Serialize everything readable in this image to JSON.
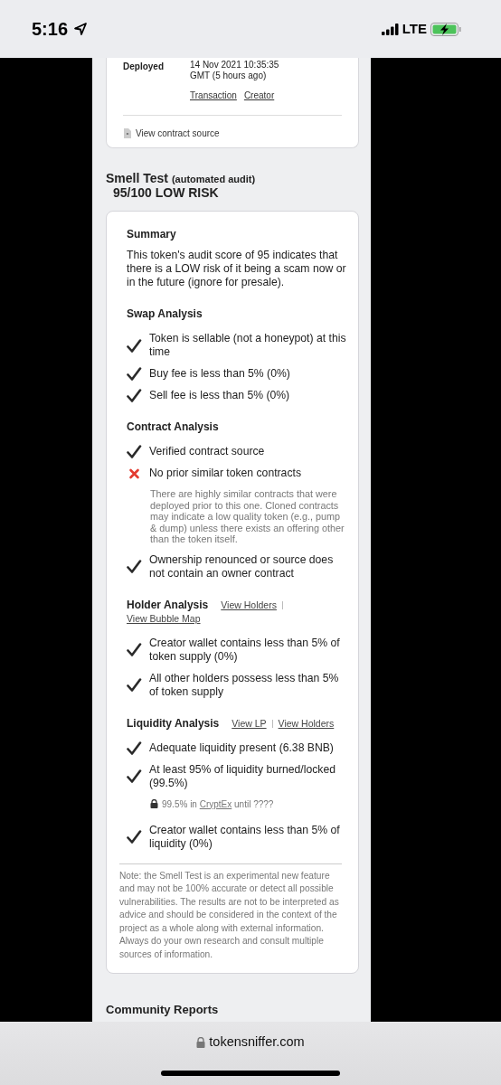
{
  "status_bar": {
    "time": "5:16",
    "network": "LTE"
  },
  "contract_card": {
    "deployed_label": "Deployed",
    "deployed_value": "14 Nov 2021 10:35:35 GMT (5 hours ago)",
    "links": [
      "Transaction",
      "Creator"
    ],
    "source_link": "View contract source"
  },
  "smell_test": {
    "title": "Smell Test",
    "subtitle": "(automated audit)",
    "score": "95/100 LOW RISK",
    "summary_heading": "Summary",
    "summary": "This token's audit score of 95 indicates that there is a LOW risk of it being a scam now or in the future (ignore for presale).",
    "sections": [
      {
        "heading": "Swap Analysis",
        "checks": [
          {
            "kind": "pass",
            "text": "Token is sellable (not a honeypot) at this time"
          },
          {
            "kind": "pass",
            "text": "Buy fee is less than 5% (0%)"
          },
          {
            "kind": "pass",
            "text": "Sell fee is less than 5% (0%)"
          }
        ]
      },
      {
        "heading": "Contract Analysis",
        "checks": [
          {
            "kind": "pass",
            "text": "Verified contract source"
          },
          {
            "kind": "fail",
            "text": "No prior similar token contracts",
            "detail": "There are highly similar contracts that were deployed prior to this one.  Cloned contracts may indicate a low quality token (e.g., pump & dump) unless there exists an offering other than the token itself."
          },
          {
            "kind": "pass",
            "text": "Ownership renounced or source does not contain an owner contract"
          }
        ]
      },
      {
        "heading": "Holder Analysis",
        "links": [
          "View Holders",
          "View Bubble Map"
        ],
        "checks": [
          {
            "kind": "pass",
            "text": "Creator wallet contains less than 5% of token supply (0%)"
          },
          {
            "kind": "pass",
            "text": "All other holders possess less than 5% of token supply"
          }
        ]
      },
      {
        "heading": "Liquidity Analysis",
        "links": [
          "View LP",
          "View Holders"
        ],
        "checks": [
          {
            "kind": "pass",
            "text": "Adequate liquidity present (6.38 BNB)"
          },
          {
            "kind": "pass",
            "text": "At least 95% of liquidity burned/locked (99.5%)",
            "lock": {
              "prefix": "99.5% in",
              "link": "CryptEx",
              "suffix": "until ????"
            }
          },
          {
            "kind": "pass",
            "text": "Creator wallet contains less than 5% of liquidity (0%)"
          }
        ]
      }
    ],
    "note": "Note: the Smell Test is an experimental new feature and may not be 100% accurate or detect all possible vulnerabilities. The results are not to be interpreted as advice and should be considered in the context of the project as a whole along with external information. Always do your own research and consult multiple sources of information."
  },
  "community_heading": "Community Reports",
  "browser": {
    "url": "tokensniffer.com"
  }
}
